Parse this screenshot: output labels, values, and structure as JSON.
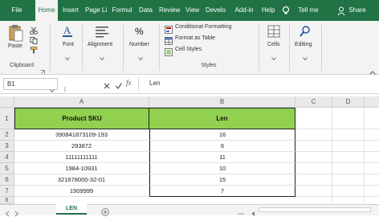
{
  "tabs": [
    "File",
    "Home",
    "Insert",
    "Page Li",
    "Formul",
    "Data",
    "Review",
    "View",
    "Develo",
    "Add-in",
    "Help"
  ],
  "tell_me": "Tell me",
  "share": "Share",
  "ribbon": {
    "paste": "Paste",
    "clipboard": "Clipboard",
    "font": "Font",
    "alignment": "Alignment",
    "number": "Number",
    "conditional_formatting": "Conditional Formatting",
    "format_as_table": "Format as Table",
    "cell_styles": "Cell Styles",
    "styles": "Styles",
    "cells": "Cells",
    "editing": "Editing"
  },
  "formula_bar": {
    "name_box": "B1",
    "fx": "fx",
    "content": "Len"
  },
  "columns": [
    "A",
    "B",
    "C",
    "D"
  ],
  "rows": [
    "1",
    "2",
    "3",
    "4",
    "5",
    "6",
    "7",
    "8"
  ],
  "table": {
    "header_a": "Product SKU",
    "header_b": "Len",
    "data": [
      [
        "390841873109-193",
        "16"
      ],
      [
        "293872",
        "6"
      ],
      [
        "11111111111",
        "11"
      ],
      [
        "1984-10931",
        "10"
      ],
      [
        "321678000-32-01",
        "15"
      ],
      [
        "1909999",
        "7"
      ]
    ]
  },
  "sheet_tab": "LEN",
  "colors": {
    "excel_green": "#217346",
    "header_fill": "#92d050"
  }
}
